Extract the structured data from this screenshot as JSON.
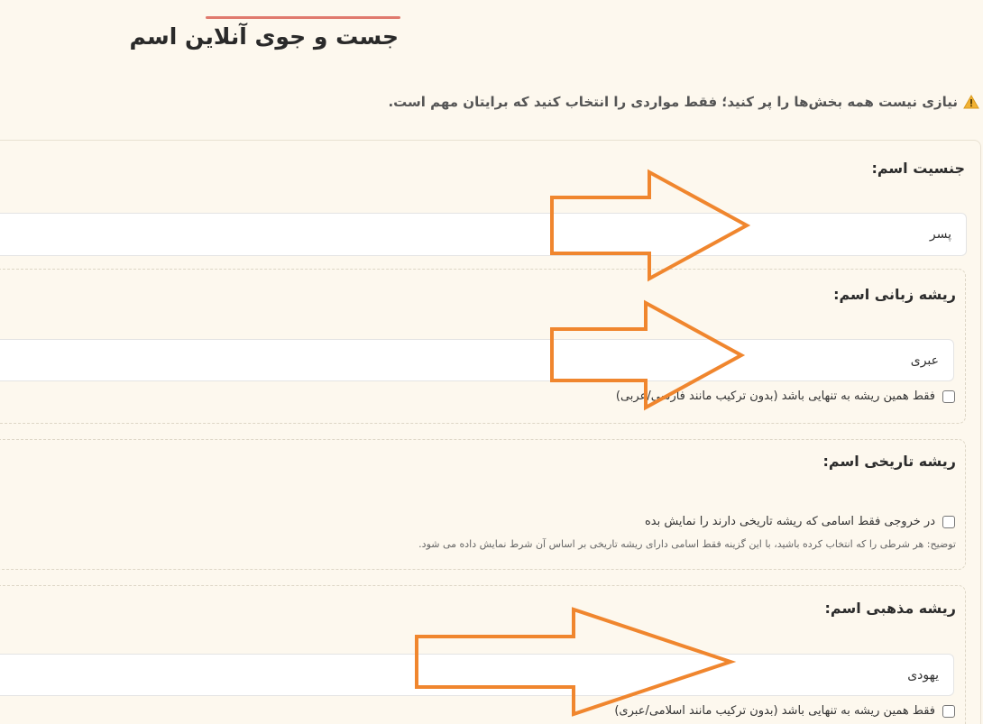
{
  "header": {
    "title": "جست و جوی آنلاین اسم"
  },
  "notice": {
    "icon": "warning-icon",
    "text": "نیازی نیست همه بخش‌ها را پر کنید؛ فقط مواردی را انتخاب کنید که برایتان مهم است."
  },
  "gender": {
    "label": "جنسیت اسم:",
    "value": "پسر"
  },
  "language_root": {
    "label": "ریشه زبانی اسم:",
    "value": "عبری",
    "only_checkbox_label": "فقط همین ریشه به تنهایی باشد (بدون ترکیب مانند فارسی/عربی)"
  },
  "historical_root": {
    "label": "ریشه تاریخی اسم:",
    "checkbox_label": "در خروجی فقط اسامی که ریشه تاریخی دارند را نمایش بده",
    "note": "توضیح: هر شرطی را که انتخاب کرده باشید، با این گزینه فقط اسامی دارای ریشه تاریخی بر اساس آن شرط نمایش داده می شود."
  },
  "religious_root": {
    "label": "ریشه مذهبی اسم:",
    "value": "یهودی",
    "only_checkbox_label": "فقط همین ریشه به تنهایی باشد (بدون ترکیب مانند اسلامی/عبری)"
  },
  "colors": {
    "background": "#fdf8ee",
    "title_underline": "#e07a6e",
    "annotation_arrow": "#f0862e",
    "warning": "#f2b233"
  }
}
